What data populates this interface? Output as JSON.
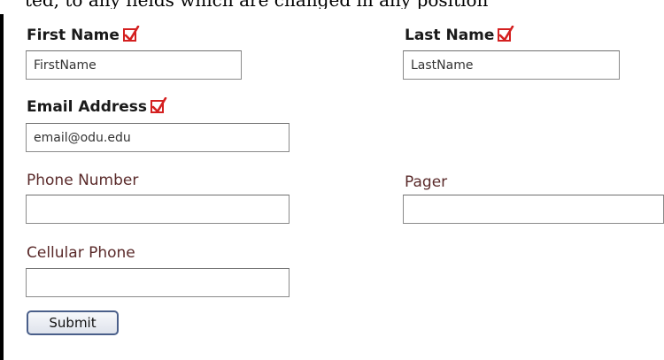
{
  "header_clip": {
    "text": "ted, to any fields which are changed in any position"
  },
  "form": {
    "first_name": {
      "label": "First Name",
      "value": "FirstName"
    },
    "last_name": {
      "label": "Last Name",
      "value": "LastName"
    },
    "email": {
      "label": "Email Address",
      "value": "email@odu.edu"
    },
    "phone": {
      "label": "Phone Number",
      "value": ""
    },
    "pager": {
      "label": "Pager",
      "value": ""
    },
    "cellular": {
      "label": "Cellular Phone",
      "value": ""
    },
    "required_icon": "checkmark-box-icon",
    "required_color": "#d42020",
    "submit_label": "Submit"
  }
}
